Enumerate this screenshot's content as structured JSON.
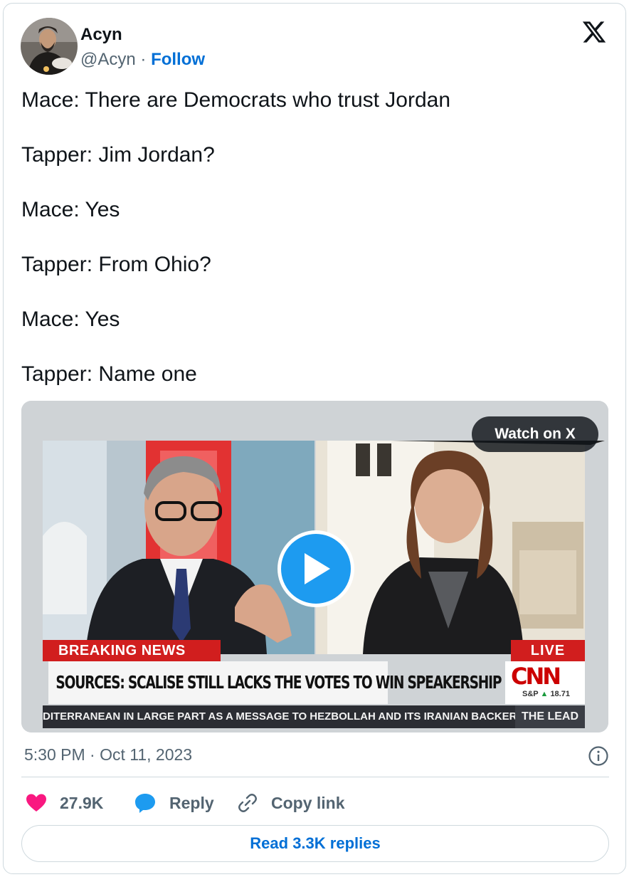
{
  "author": {
    "display_name": "Acyn",
    "handle": "@Acyn",
    "separator": "·",
    "follow_label": "Follow"
  },
  "tweet": {
    "lines": [
      "Mace: There are Democrats who trust Jordan",
      "Tapper: Jim Jordan?",
      "Mace: Yes",
      "Tapper: From Ohio?",
      "Mace: Yes",
      "Tapper: Name one"
    ]
  },
  "video": {
    "watch_label": "Watch on X",
    "breaking_label": "BREAKING NEWS",
    "live_label": "LIVE",
    "headline": "SOURCES: SCALISE STILL LACKS THE VOTES TO WIN SPEAKERSHIP",
    "network_logo": "CNN",
    "market_label": "S&P",
    "market_arrow": "▲",
    "market_value": "18.71",
    "ticker_text": "DITERRANEAN IN LARGE PART AS A MESSAGE TO HEZBOLLAH AND ITS IRANIAN BACKER",
    "show_name": "THE LEAD"
  },
  "meta": {
    "timestamp": "5:30 PM · Oct 11, 2023"
  },
  "actions": {
    "like_count": "27.9K",
    "reply_label": "Reply",
    "copy_label": "Copy link",
    "read_replies_label": "Read 3.3K replies"
  },
  "colors": {
    "like": "#f91880",
    "accent": "#1d9bf0",
    "link": "#006fd6",
    "muted": "#536471",
    "breaking_red": "#d11e1e"
  },
  "icons": {
    "brand": "x-logo-icon",
    "play": "play-icon",
    "info": "info-icon",
    "like": "heart-icon",
    "reply": "reply-bubble-icon",
    "copy": "link-icon"
  }
}
